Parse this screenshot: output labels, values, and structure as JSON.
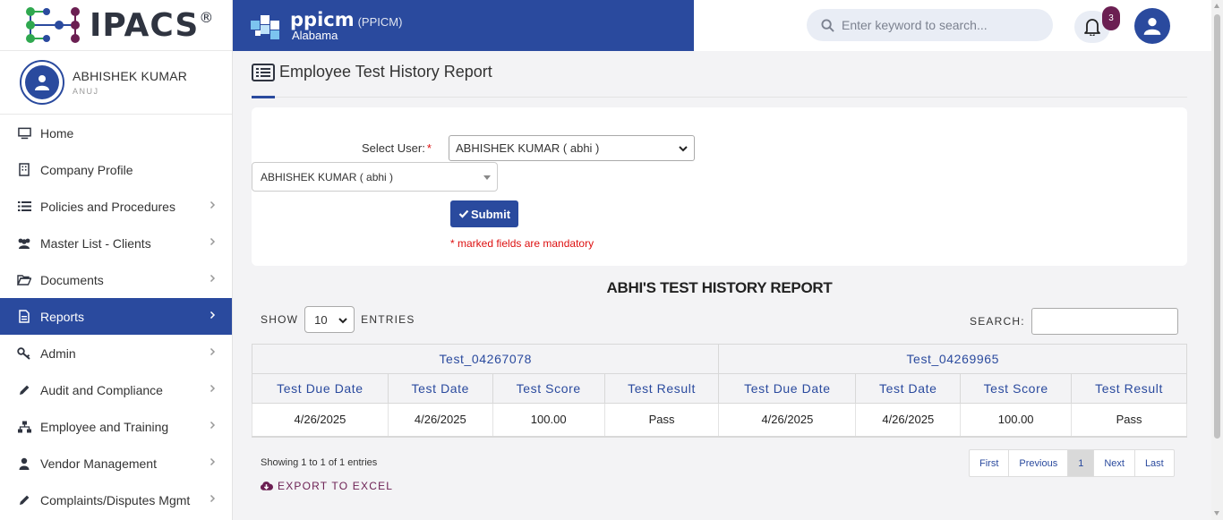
{
  "logo": {
    "text": "IPACS",
    "reg": "®"
  },
  "user": {
    "name": "ABHISHEK KUMAR",
    "sub": "ANUJ"
  },
  "nav": [
    {
      "label": "Home",
      "icon": "monitor-icon",
      "chevron": false
    },
    {
      "label": "Company Profile",
      "icon": "building-icon",
      "chevron": false
    },
    {
      "label": "Policies and Procedures",
      "icon": "list-icon",
      "chevron": true
    },
    {
      "label": "Master List - Clients",
      "icon": "users-icon",
      "chevron": true
    },
    {
      "label": "Documents",
      "icon": "folder-open-icon",
      "chevron": true
    },
    {
      "label": "Reports",
      "icon": "file-icon",
      "chevron": true,
      "active": true
    },
    {
      "label": "Admin",
      "icon": "key-icon",
      "chevron": true
    },
    {
      "label": "Audit and Compliance",
      "icon": "pencil-icon",
      "chevron": true
    },
    {
      "label": "Employee and Training",
      "icon": "sitemap-icon",
      "chevron": true
    },
    {
      "label": "Vendor Management",
      "icon": "user-icon",
      "chevron": true
    },
    {
      "label": "Complaints/Disputes Mgmt",
      "icon": "pencil-icon",
      "chevron": true
    }
  ],
  "brand": {
    "name": "ppicm",
    "code": "(PPICM)",
    "state": "Alabama"
  },
  "header": {
    "search_placeholder": "Enter keyword to search...",
    "notification_count": "3"
  },
  "page": {
    "title": "Employee Test History Report"
  },
  "form": {
    "select_user_label": "Select User:",
    "required_mark": "*",
    "selected_user": "ABHISHEK KUMAR ( abhi )",
    "selected_user_custom": "ABHISHEK KUMAR ( abhi )",
    "submit_label": "Submit",
    "mandatory_note": "* marked fields are mandatory"
  },
  "report": {
    "title": "ABHI'S TEST HISTORY REPORT",
    "show_label": "SHOW",
    "entries_value": "10",
    "entries_label": "ENTRIES",
    "search_label": "SEARCH:",
    "groups": [
      "Test_04267078",
      "Test_04269965"
    ],
    "columns": [
      "Test Due Date",
      "Test Date",
      "Test Score",
      "Test Result",
      "Test Due Date",
      "Test Date",
      "Test Score",
      "Test Result"
    ],
    "rows": [
      [
        "4/26/2025",
        "4/26/2025",
        "100.00",
        "Pass",
        "4/26/2025",
        "4/26/2025",
        "100.00",
        "Pass"
      ]
    ],
    "showing_text": "Showing 1 to 1 of 1 entries",
    "pagination": {
      "first": "First",
      "previous": "Previous",
      "current": "1",
      "next": "Next",
      "last": "Last"
    },
    "export_label": "EXPORT TO EXCEL"
  },
  "colors": {
    "primary": "#2a4a9e",
    "accent": "#6b1f52",
    "required": "#dd1111"
  }
}
